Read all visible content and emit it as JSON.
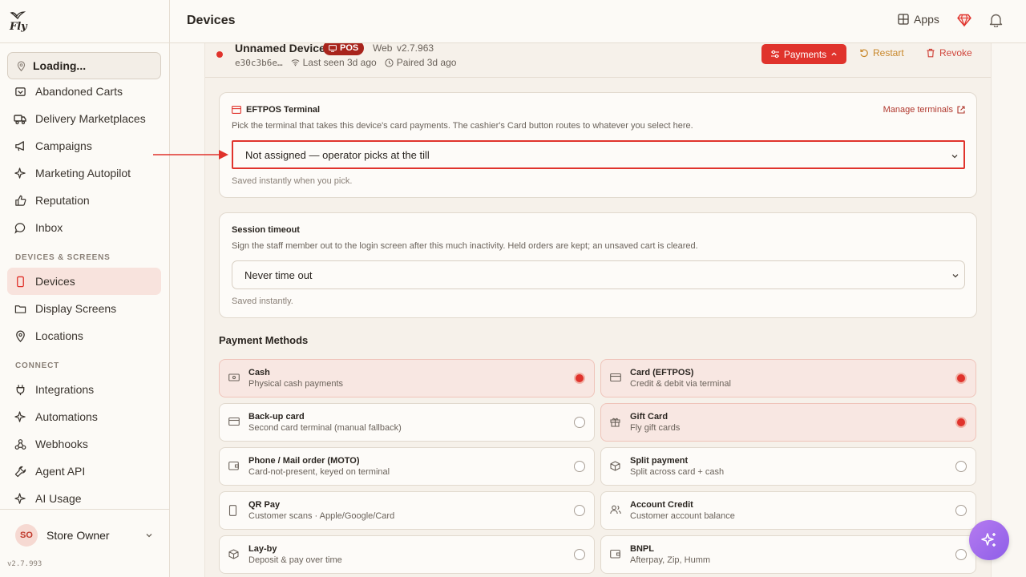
{
  "app": {
    "logo_text": "Fly",
    "version": "v2.7.993"
  },
  "header": {
    "title": "Devices",
    "apps_label": "Apps"
  },
  "sidebar": {
    "location": "Loading...",
    "items_top": [
      {
        "label": "Abandoned Carts",
        "icon": "cart-icon"
      },
      {
        "label": "Delivery Marketplaces",
        "icon": "truck-icon"
      },
      {
        "label": "Campaigns",
        "icon": "megaphone-icon"
      },
      {
        "label": "Marketing Autopilot",
        "icon": "sparkle-icon"
      },
      {
        "label": "Reputation",
        "icon": "thumbs-up-icon"
      },
      {
        "label": "Inbox",
        "icon": "chat-icon"
      }
    ],
    "section_devices": "DEVICES & SCREENS",
    "items_devices": [
      {
        "label": "Devices",
        "icon": "phone-icon"
      },
      {
        "label": "Display Screens",
        "icon": "folder-icon"
      },
      {
        "label": "Locations",
        "icon": "map-pin-icon"
      }
    ],
    "section_connect": "CONNECT",
    "items_connect": [
      {
        "label": "Integrations",
        "icon": "plug-icon"
      },
      {
        "label": "Automations",
        "icon": "zap-icon"
      },
      {
        "label": "Webhooks",
        "icon": "webhook-icon"
      },
      {
        "label": "Agent API",
        "icon": "wrench-icon"
      },
      {
        "label": "AI Usage",
        "icon": "sparkle-icon"
      }
    ],
    "owner_initials": "SO",
    "owner_name": "Store Owner"
  },
  "device": {
    "name": "Unnamed Device",
    "badge": "POS",
    "platform": "Web",
    "version": "v2.7.963",
    "id": "e30c3b6e…",
    "last_seen": "Last seen 3d ago",
    "paired": "Paired 3d ago",
    "payments_btn": "Payments",
    "restart_btn": "Restart",
    "revoke_btn": "Revoke"
  },
  "eftpos": {
    "title": "EFTPOS Terminal",
    "manage": "Manage terminals",
    "desc": "Pick the terminal that takes this device's card payments. The cashier's Card button routes to whatever you select here.",
    "value": "Not assigned — operator picks at the till",
    "hint": "Saved instantly when you pick."
  },
  "session": {
    "title": "Session timeout",
    "desc": "Sign the staff member out to the login screen after this much inactivity. Held orders are kept; an unsaved cart is cleared.",
    "value": "Never time out",
    "hint": "Saved instantly."
  },
  "payment_methods": {
    "heading": "Payment Methods",
    "items": [
      {
        "name": "Cash",
        "desc": "Physical cash payments",
        "on": true
      },
      {
        "name": "Card (EFTPOS)",
        "desc": "Credit & debit via terminal",
        "on": true
      },
      {
        "name": "Back-up card",
        "desc": "Second card terminal (manual fallback)",
        "on": false
      },
      {
        "name": "Gift Card",
        "desc": "Fly gift cards",
        "on": true
      },
      {
        "name": "Phone / Mail order (MOTO)",
        "desc": "Card-not-present, keyed on terminal",
        "on": false
      },
      {
        "name": "Split payment",
        "desc": "Split across card + cash",
        "on": false
      },
      {
        "name": "QR Pay",
        "desc": "Customer scans · Apple/Google/Card",
        "on": false
      },
      {
        "name": "Account Credit",
        "desc": "Customer account balance",
        "on": false
      },
      {
        "name": "Lay-by",
        "desc": "Deposit & pay over time",
        "on": false
      },
      {
        "name": "BNPL",
        "desc": "Afterpay, Zip, Humm",
        "on": false
      }
    ]
  },
  "colors": {
    "accent": "#e0332c",
    "badge": "#a8241c",
    "restart": "#c8872a",
    "fab": "#9b6bec"
  }
}
